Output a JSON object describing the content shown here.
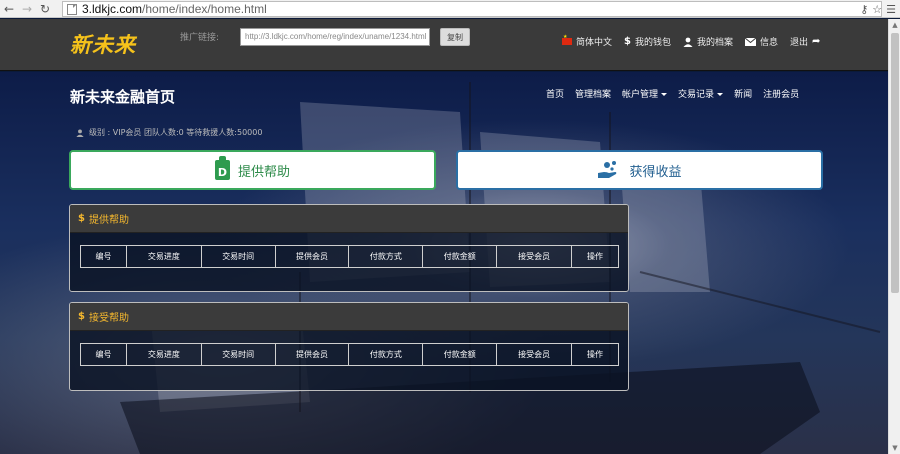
{
  "browser": {
    "url_host": "3.ldkjc.com",
    "url_path": "/home/index/home.html"
  },
  "header": {
    "logo": "新未来",
    "promo_label": "推广链接:",
    "promo_link": "http://3.ldkjc.com/home/reg/index/uname/1234.html",
    "copy_label": "复制",
    "links": [
      {
        "label": "简体中文",
        "icon": "china-flag-icon"
      },
      {
        "label": "我的钱包",
        "icon": "dollar-icon"
      },
      {
        "label": "我的档案",
        "icon": "user-icon"
      },
      {
        "label": "信息",
        "icon": "envelope-icon"
      },
      {
        "label": "退出",
        "icon": "share-arrow-icon"
      }
    ]
  },
  "page": {
    "title": "新未来金融首页",
    "nav": [
      "首页",
      "管理档案",
      "帐户管理",
      "交易记录",
      "新闻",
      "注册会员"
    ],
    "member_info": "级别 : VIP会员  团队人数:0 等待救援人数:50000"
  },
  "actions": {
    "provide": "提供帮助",
    "receive": "获得收益"
  },
  "panels": [
    {
      "title": "提供帮助",
      "columns": [
        "编号",
        "交易进度",
        "交易时间",
        "提供会员",
        "付款方式",
        "付款金额",
        "接受会员",
        "操作"
      ]
    },
    {
      "title": "接受帮助",
      "columns": [
        "编号",
        "交易进度",
        "交易时间",
        "提供会员",
        "付款方式",
        "付款金额",
        "接受会员",
        "操作"
      ]
    }
  ],
  "colors": {
    "logo": "#f5c21b",
    "provide_accent": "#3aa85c",
    "receive_accent": "#2a6fa5",
    "panel_title": "#f5b82e"
  }
}
